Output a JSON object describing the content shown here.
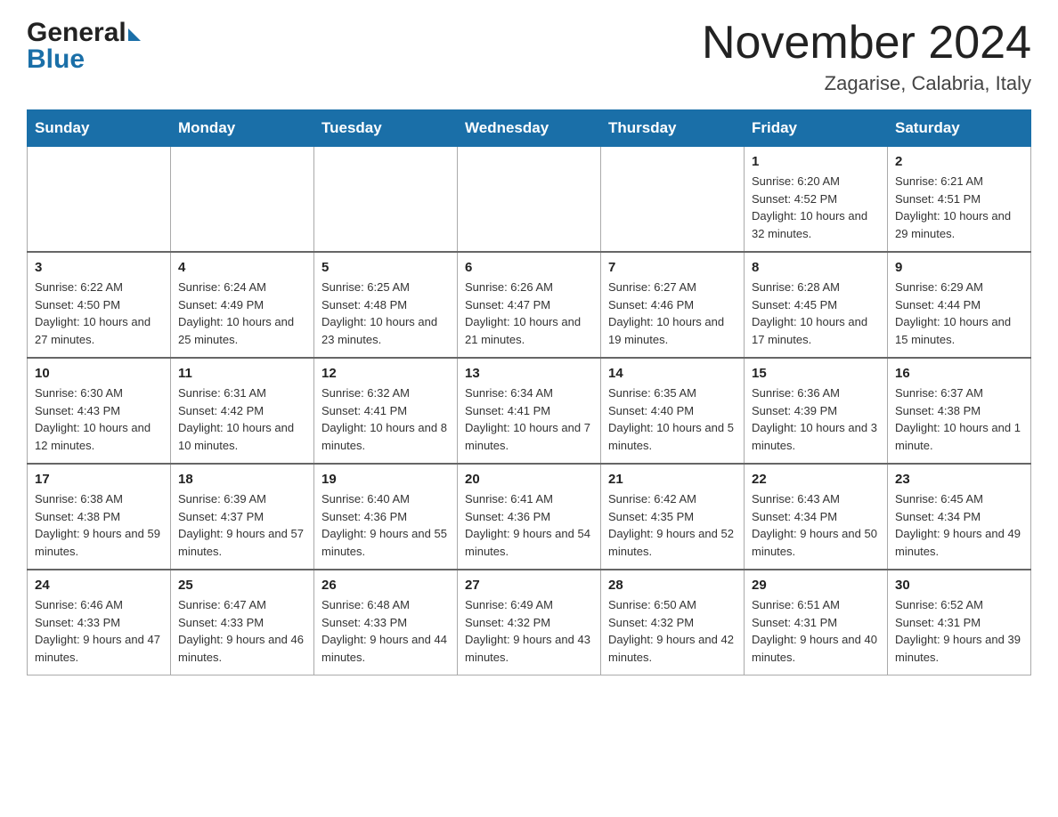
{
  "header": {
    "logo_general": "General",
    "logo_blue": "Blue",
    "month_title": "November 2024",
    "location": "Zagarise, Calabria, Italy"
  },
  "days_of_week": [
    "Sunday",
    "Monday",
    "Tuesday",
    "Wednesday",
    "Thursday",
    "Friday",
    "Saturday"
  ],
  "weeks": [
    [
      {
        "day": "",
        "info": ""
      },
      {
        "day": "",
        "info": ""
      },
      {
        "day": "",
        "info": ""
      },
      {
        "day": "",
        "info": ""
      },
      {
        "day": "",
        "info": ""
      },
      {
        "day": "1",
        "info": "Sunrise: 6:20 AM\nSunset: 4:52 PM\nDaylight: 10 hours and 32 minutes."
      },
      {
        "day": "2",
        "info": "Sunrise: 6:21 AM\nSunset: 4:51 PM\nDaylight: 10 hours and 29 minutes."
      }
    ],
    [
      {
        "day": "3",
        "info": "Sunrise: 6:22 AM\nSunset: 4:50 PM\nDaylight: 10 hours and 27 minutes."
      },
      {
        "day": "4",
        "info": "Sunrise: 6:24 AM\nSunset: 4:49 PM\nDaylight: 10 hours and 25 minutes."
      },
      {
        "day": "5",
        "info": "Sunrise: 6:25 AM\nSunset: 4:48 PM\nDaylight: 10 hours and 23 minutes."
      },
      {
        "day": "6",
        "info": "Sunrise: 6:26 AM\nSunset: 4:47 PM\nDaylight: 10 hours and 21 minutes."
      },
      {
        "day": "7",
        "info": "Sunrise: 6:27 AM\nSunset: 4:46 PM\nDaylight: 10 hours and 19 minutes."
      },
      {
        "day": "8",
        "info": "Sunrise: 6:28 AM\nSunset: 4:45 PM\nDaylight: 10 hours and 17 minutes."
      },
      {
        "day": "9",
        "info": "Sunrise: 6:29 AM\nSunset: 4:44 PM\nDaylight: 10 hours and 15 minutes."
      }
    ],
    [
      {
        "day": "10",
        "info": "Sunrise: 6:30 AM\nSunset: 4:43 PM\nDaylight: 10 hours and 12 minutes."
      },
      {
        "day": "11",
        "info": "Sunrise: 6:31 AM\nSunset: 4:42 PM\nDaylight: 10 hours and 10 minutes."
      },
      {
        "day": "12",
        "info": "Sunrise: 6:32 AM\nSunset: 4:41 PM\nDaylight: 10 hours and 8 minutes."
      },
      {
        "day": "13",
        "info": "Sunrise: 6:34 AM\nSunset: 4:41 PM\nDaylight: 10 hours and 7 minutes."
      },
      {
        "day": "14",
        "info": "Sunrise: 6:35 AM\nSunset: 4:40 PM\nDaylight: 10 hours and 5 minutes."
      },
      {
        "day": "15",
        "info": "Sunrise: 6:36 AM\nSunset: 4:39 PM\nDaylight: 10 hours and 3 minutes."
      },
      {
        "day": "16",
        "info": "Sunrise: 6:37 AM\nSunset: 4:38 PM\nDaylight: 10 hours and 1 minute."
      }
    ],
    [
      {
        "day": "17",
        "info": "Sunrise: 6:38 AM\nSunset: 4:38 PM\nDaylight: 9 hours and 59 minutes."
      },
      {
        "day": "18",
        "info": "Sunrise: 6:39 AM\nSunset: 4:37 PM\nDaylight: 9 hours and 57 minutes."
      },
      {
        "day": "19",
        "info": "Sunrise: 6:40 AM\nSunset: 4:36 PM\nDaylight: 9 hours and 55 minutes."
      },
      {
        "day": "20",
        "info": "Sunrise: 6:41 AM\nSunset: 4:36 PM\nDaylight: 9 hours and 54 minutes."
      },
      {
        "day": "21",
        "info": "Sunrise: 6:42 AM\nSunset: 4:35 PM\nDaylight: 9 hours and 52 minutes."
      },
      {
        "day": "22",
        "info": "Sunrise: 6:43 AM\nSunset: 4:34 PM\nDaylight: 9 hours and 50 minutes."
      },
      {
        "day": "23",
        "info": "Sunrise: 6:45 AM\nSunset: 4:34 PM\nDaylight: 9 hours and 49 minutes."
      }
    ],
    [
      {
        "day": "24",
        "info": "Sunrise: 6:46 AM\nSunset: 4:33 PM\nDaylight: 9 hours and 47 minutes."
      },
      {
        "day": "25",
        "info": "Sunrise: 6:47 AM\nSunset: 4:33 PM\nDaylight: 9 hours and 46 minutes."
      },
      {
        "day": "26",
        "info": "Sunrise: 6:48 AM\nSunset: 4:33 PM\nDaylight: 9 hours and 44 minutes."
      },
      {
        "day": "27",
        "info": "Sunrise: 6:49 AM\nSunset: 4:32 PM\nDaylight: 9 hours and 43 minutes."
      },
      {
        "day": "28",
        "info": "Sunrise: 6:50 AM\nSunset: 4:32 PM\nDaylight: 9 hours and 42 minutes."
      },
      {
        "day": "29",
        "info": "Sunrise: 6:51 AM\nSunset: 4:31 PM\nDaylight: 9 hours and 40 minutes."
      },
      {
        "day": "30",
        "info": "Sunrise: 6:52 AM\nSunset: 4:31 PM\nDaylight: 9 hours and 39 minutes."
      }
    ]
  ]
}
